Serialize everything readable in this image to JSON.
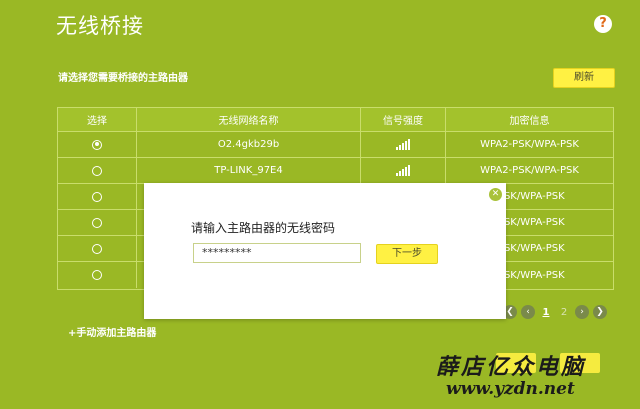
{
  "page": {
    "title": "无线桥接",
    "help_icon": "?"
  },
  "section": {
    "subtitle": "请选择您需要桥接的主路由器",
    "refresh_label": "刷新"
  },
  "table": {
    "headers": [
      "选择",
      "无线网络名称",
      "信号强度",
      "加密信息"
    ],
    "rows": [
      {
        "selected": true,
        "ssid": "O2.4gkb29b",
        "encryption": "WPA2-PSK/WPA-PSK"
      },
      {
        "selected": false,
        "ssid": "TP-LINK_97E4",
        "encryption": "WPA2-PSK/WPA-PSK"
      },
      {
        "selected": false,
        "ssid": "",
        "encryption": "-PSK/WPA-PSK"
      },
      {
        "selected": false,
        "ssid": "",
        "encryption": "-PSK/WPA-PSK"
      },
      {
        "selected": false,
        "ssid": "",
        "encryption": "-PSK/WPA-PSK"
      },
      {
        "selected": false,
        "ssid": "",
        "encryption": "-PSK/WPA-PSK"
      }
    ]
  },
  "pagination": {
    "current": "1",
    "next": "2"
  },
  "manual_add": "+手动添加主路由器",
  "modal": {
    "label": "请输入主路由器的无线密码",
    "password_value": "*********",
    "next_label": "下一步"
  },
  "watermark": {
    "line1": "薛店亿众电脑",
    "line2": "www.yzdn.net"
  },
  "colors": {
    "background": "#9ab825",
    "button": "#fff143",
    "modal": "#ffffff"
  },
  "icons": {
    "help": "help-icon",
    "close": "close-icon",
    "signal": "signal-icon",
    "radio": "radio-icon"
  }
}
